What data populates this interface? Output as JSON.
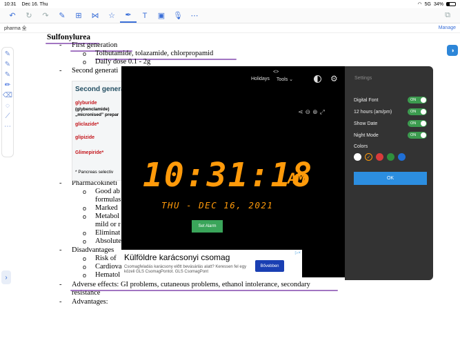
{
  "status": {
    "time": "10:31",
    "date": "Dec 16. Thu",
    "signal": "5G",
    "battery": "34%",
    "battery_level": 0.34
  },
  "toolbar": {
    "left_icons": [
      "undo-icon",
      "redo-icon",
      "redo-disabled-icon",
      "read-mode-icon",
      "add-page-icon",
      "shape-icon",
      "favorite-icon"
    ],
    "right_icons": [
      "pen-icon",
      "text-icon",
      "image-icon",
      "mic-icon",
      "more-icon"
    ]
  },
  "tab": {
    "name": "pharma 全",
    "manage": "Manage"
  },
  "document": {
    "heading": "Sulfonylurea",
    "bullet_first_gen": "First generation",
    "sub_drugs": "Tolbutamide, tolazamide, chlorpropamid",
    "sub_dose": "Daily dose 0.1 - 2g",
    "bullet_second_gen": "Second generati",
    "bullet_pharmaco": "Pharmacokineti",
    "sub_good": "Good ab",
    "sub_formulas": "formulas",
    "sub_marked": "Marked",
    "sub_metabol": "Metabol",
    "sub_mild": "mild or r",
    "sub_elimina": "Eliminat",
    "sub_absolute": "Absolute",
    "bullet_disadv": "Disadvantages",
    "sub_risk": "Risk of",
    "sub_cardio": "Cardiova",
    "sub_hemato": "Hematol",
    "bullet_adverse": "Adverse effects: GI problems, cutaneous problems, ethanol intolerance, secondary",
    "adverse_cont": "resistance",
    "bullet_adv": "Advantages:",
    "dash": "-",
    "circle": "o"
  },
  "embed": {
    "title": "Second generat",
    "glyburide": "glyburide",
    "glybenclamide": "(glybenclamide)",
    "micronised": "„micronised” prepar",
    "gliclazide": "gliclazide*",
    "glipizide": "glipizide",
    "glimepiride": "Glimepiride*",
    "footnote": "* Pancreas selectiv"
  },
  "clock": {
    "nav_holidays": "Holidays",
    "nav_tools": "Tools ⌄",
    "top_chevron": "<>",
    "time": "10:31:18",
    "ampm": "AM",
    "date": "THU - DEC 16, 2021",
    "set_alarm": "Set Alarm"
  },
  "settings": {
    "header": "Settings",
    "rows": [
      {
        "label": "Digital Font",
        "state": "ON"
      },
      {
        "label": "12 hours (am/pm)",
        "state": "ON"
      },
      {
        "label": "Show Date",
        "state": "ON"
      },
      {
        "label": "Night Mode",
        "state": "ON"
      }
    ],
    "colors_label": "Colors",
    "colors": [
      "#ffffff",
      "#ff9a0a",
      "#d93b3b",
      "#2f8f3c",
      "#1f6fd6"
    ],
    "selected_mark": "✓",
    "ok": "OK"
  },
  "ad": {
    "headline": "Külföldre karácsonyi csomag",
    "desc": "Csomagfeladás karácsony előtt bevásárlás alatt? Keressen fel egy közeli GLS CsomagPontot. GLS CsomagPont",
    "button": "Bővebben",
    "adchoice": "▷×"
  }
}
